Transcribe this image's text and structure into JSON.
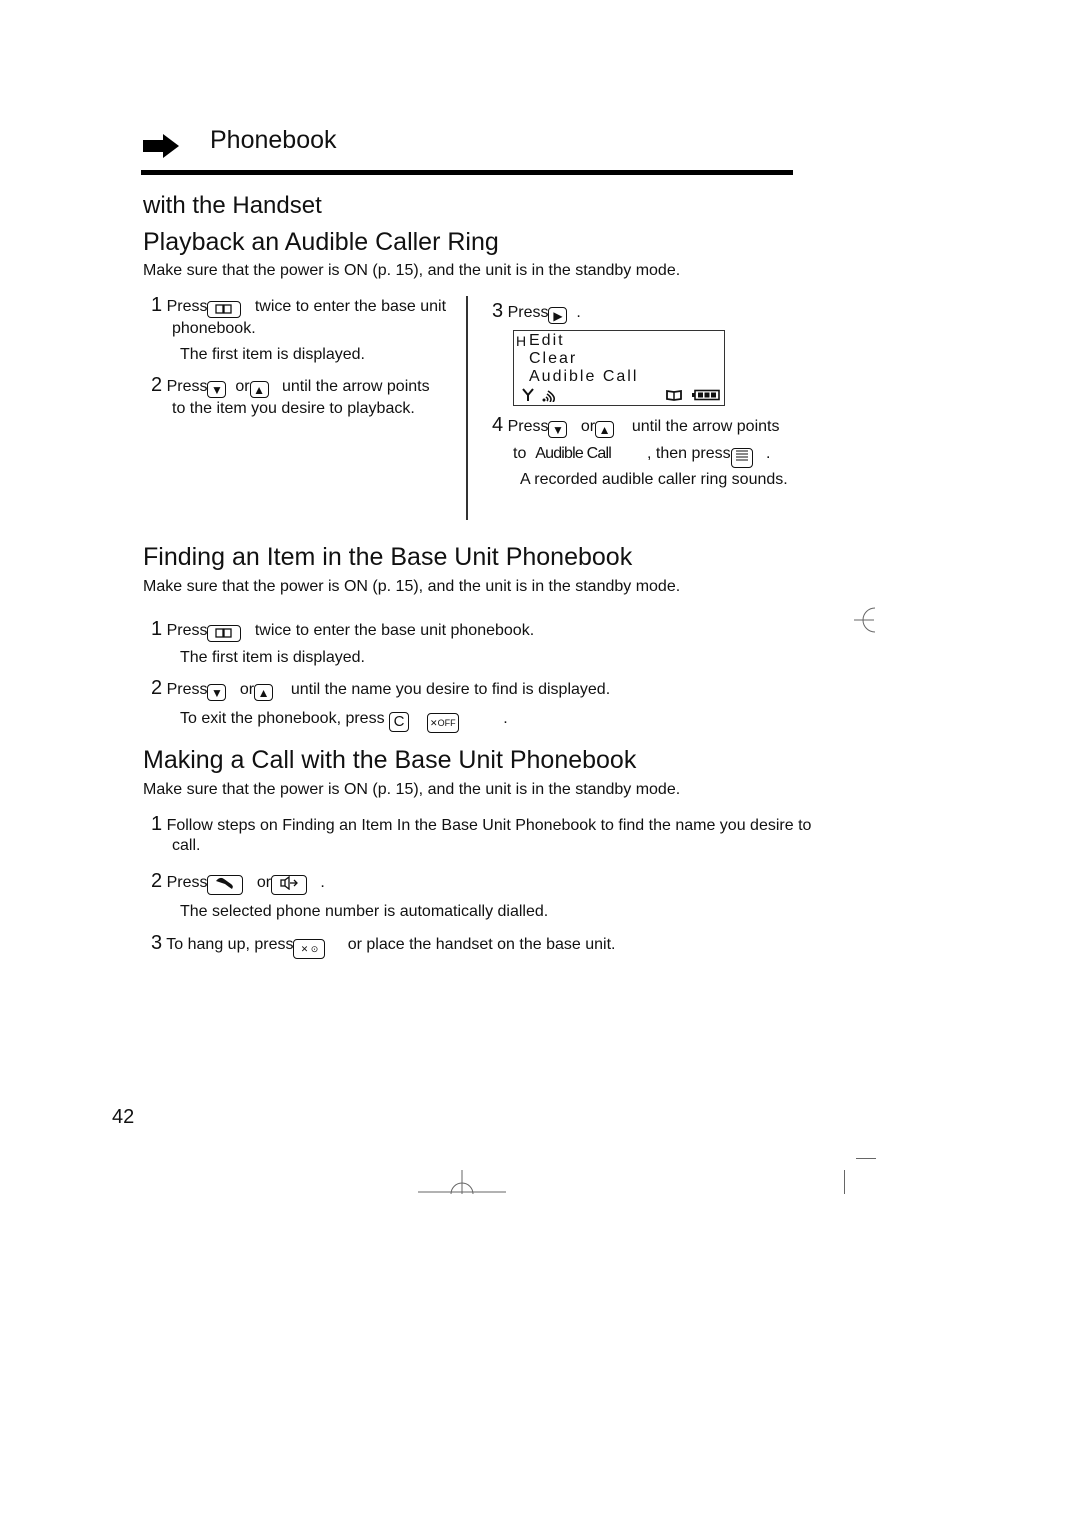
{
  "header": {
    "title": "Phonebook",
    "subtitle": "with the Handset"
  },
  "sections": {
    "playback": {
      "title": "Playback an Audible Caller Ring",
      "note": "Make sure that the power is ON (p. 15), and the unit is in the standby mode.",
      "steps": [
        {
          "num": "1",
          "pre": "Press",
          "post": "twice to enter the base unit",
          "line2": "phonebook.",
          "sub": "The first item is displayed."
        },
        {
          "num": "2",
          "pre": "Press",
          "or": "or",
          "post": "until the arrow points",
          "line2": "to the item you desire to playback."
        },
        {
          "num": "3",
          "pre": "Press",
          "post": "."
        },
        {
          "num": "4",
          "pre": "Press",
          "or": "or",
          "post": "until the arrow points",
          "to": "to",
          "target": "Audible Call",
          "then": ", then press",
          "end": ".",
          "sub": "A recorded audible caller ring sounds."
        }
      ],
      "lcd": {
        "cursor": "H",
        "items": [
          "Edit",
          "Clear",
          "Audible Call"
        ]
      }
    },
    "finding": {
      "title": "Finding an Item in the Base Unit Phonebook",
      "note": "Make sure that the power is ON (p. 15), and the unit is in the standby mode.",
      "steps": [
        {
          "num": "1",
          "pre": "Press",
          "post": "twice to enter the base unit phonebook.",
          "sub": "The first item is displayed."
        },
        {
          "num": "2",
          "pre": "Press",
          "or": "or",
          "post": "until the name you desire to find is displayed.",
          "sub_pre": "To exit the phonebook, press",
          "sub_end": "."
        }
      ]
    },
    "making": {
      "title": "Making a Call with the Base Unit Phonebook",
      "note": "Make sure that the power is ON (p. 15), and the unit is in the standby mode.",
      "steps": [
        {
          "num": "1",
          "text": "Follow steps on Finding an Item In the Base Unit Phonebook to find the name you desire to",
          "line2": "call."
        },
        {
          "num": "2",
          "pre": "Press",
          "or": "or",
          "end": ".",
          "sub": "The selected phone number is automatically dialled."
        },
        {
          "num": "3",
          "pre": "To hang up, press",
          "post": "or place the handset on the base unit."
        }
      ]
    }
  },
  "keys": {
    "clear": "C",
    "off": "OFF"
  },
  "page_number": "42"
}
